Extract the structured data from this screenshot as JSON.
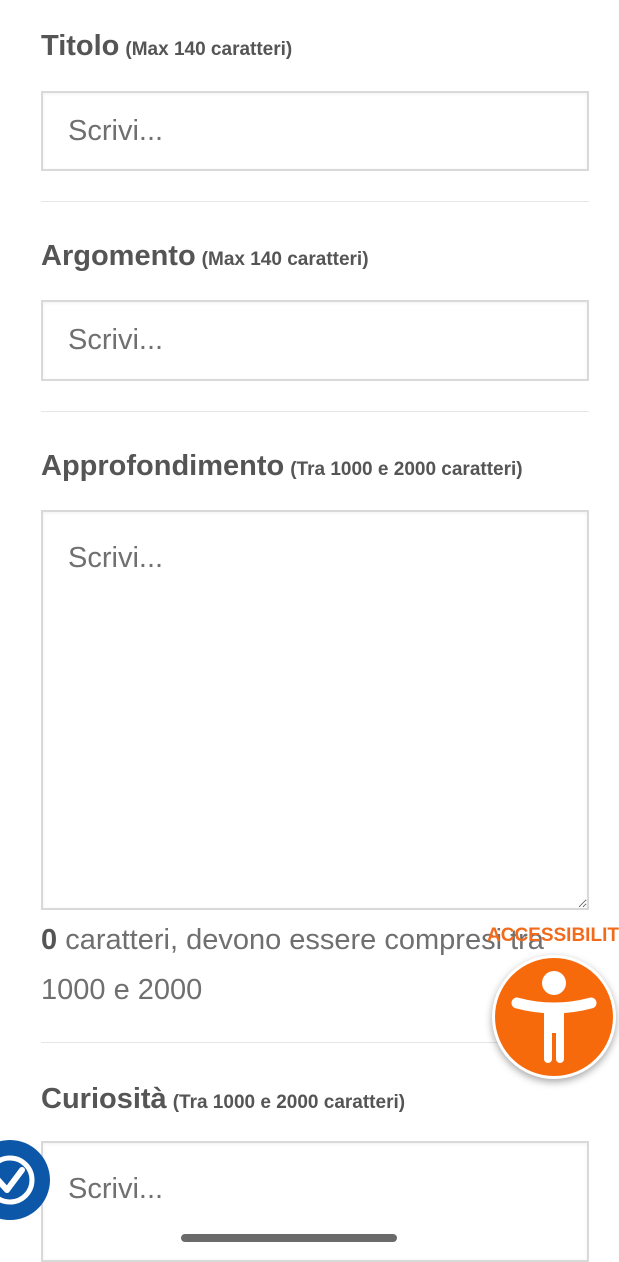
{
  "fields": {
    "titolo": {
      "label": "Titolo",
      "hint": "(Max 140 caratteri)",
      "placeholder": "Scrivi..."
    },
    "argomento": {
      "label": "Argomento",
      "hint": "(Max 140 caratteri)",
      "placeholder": "Scrivi..."
    },
    "approfondimento": {
      "label": "Approfondimento",
      "hint": "(Tra 1000 e 2000 caratteri)",
      "placeholder": "Scrivi...",
      "counter": {
        "count": "0",
        "text": " caratteri, devono essere compresi tra 1000 e 2000"
      }
    },
    "curiosita": {
      "label": "Curiosità",
      "hint": "(Tra 1000 e 2000 caratteri)",
      "placeholder": "Scrivi..."
    }
  },
  "accessibility": {
    "label": "ACCESSIBILITÀ",
    "color": "#f76a0c",
    "icon": "accessibility-person-icon"
  },
  "verify_badge": {
    "color": "#0d57a8",
    "icon": "check-shield-icon"
  }
}
